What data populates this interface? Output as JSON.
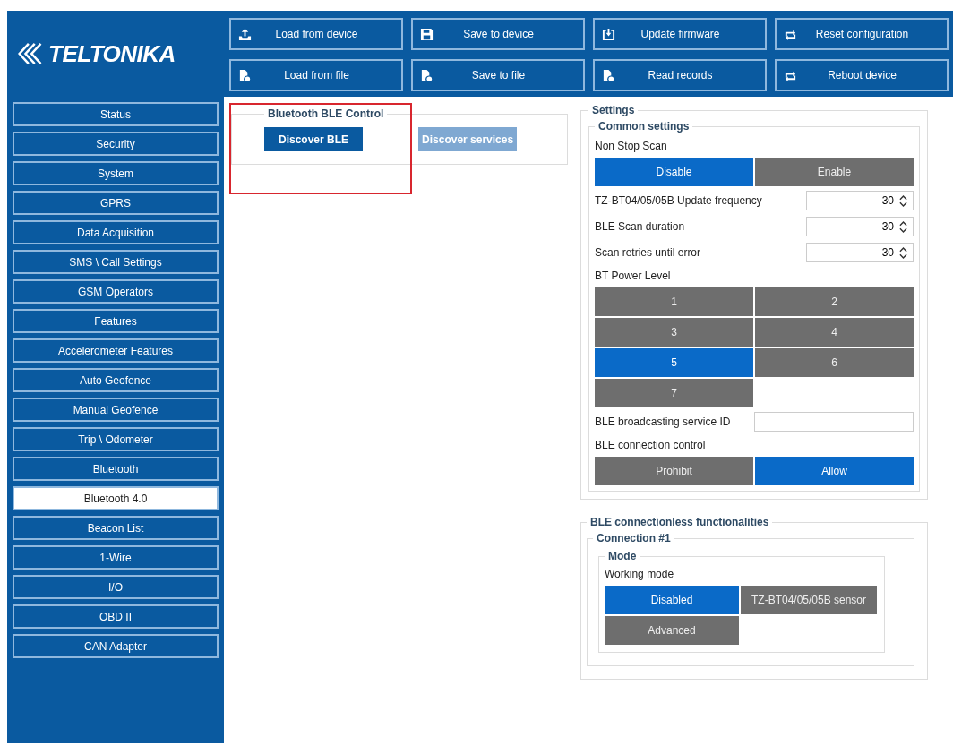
{
  "logo": {
    "text": "TELTONIKA"
  },
  "toolbar": [
    {
      "label": "Load from device",
      "kind": "upload"
    },
    {
      "label": "Save to device",
      "kind": "save"
    },
    {
      "label": "Update firmware",
      "kind": "update"
    },
    {
      "label": "Reset configuration",
      "kind": "reset"
    },
    {
      "label": "Load from file",
      "kind": "file"
    },
    {
      "label": "Save to file",
      "kind": "file"
    },
    {
      "label": "Read records",
      "kind": "file"
    },
    {
      "label": "Reboot device",
      "kind": "reset"
    }
  ],
  "sidebar": {
    "items": [
      {
        "label": "Status",
        "selected": false
      },
      {
        "label": "Security",
        "selected": false
      },
      {
        "label": "System",
        "selected": false
      },
      {
        "label": "GPRS",
        "selected": false
      },
      {
        "label": "Data Acquisition",
        "selected": false
      },
      {
        "label": "SMS \\ Call Settings",
        "selected": false
      },
      {
        "label": "GSM Operators",
        "selected": false
      },
      {
        "label": "Features",
        "selected": false
      },
      {
        "label": "Accelerometer Features",
        "selected": false
      },
      {
        "label": "Auto Geofence",
        "selected": false
      },
      {
        "label": "Manual Geofence",
        "selected": false
      },
      {
        "label": "Trip \\ Odometer",
        "selected": false
      },
      {
        "label": "Bluetooth",
        "selected": false
      },
      {
        "label": "Bluetooth 4.0",
        "selected": true
      },
      {
        "label": "Beacon List",
        "selected": false
      },
      {
        "label": "1-Wire",
        "selected": false
      },
      {
        "label": "I/O",
        "selected": false
      },
      {
        "label": "OBD II",
        "selected": false
      },
      {
        "label": "CAN Adapter",
        "selected": false
      }
    ]
  },
  "ble_control": {
    "title": "Bluetooth BLE Control",
    "buttons": [
      {
        "label": "Discover BLE",
        "disabled": false
      },
      {
        "label": "Discover services",
        "disabled": true
      }
    ]
  },
  "settings": {
    "title": "Settings",
    "common": {
      "title": "Common settings",
      "non_stop_scan": {
        "label": "Non Stop Scan",
        "options": [
          {
            "label": "Disable",
            "selected": true
          },
          {
            "label": "Enable",
            "selected": false
          }
        ]
      },
      "fields": [
        {
          "label": "TZ-BT04/05/05B Update frequency",
          "value": "30"
        },
        {
          "label": "BLE Scan duration",
          "value": "30"
        },
        {
          "label": "Scan retries until error",
          "value": "30"
        }
      ],
      "power_level": {
        "label": "BT Power Level",
        "options": [
          {
            "label": "1",
            "selected": false
          },
          {
            "label": "2",
            "selected": false
          },
          {
            "label": "3",
            "selected": false
          },
          {
            "label": "4",
            "selected": false
          },
          {
            "label": "5",
            "selected": true
          },
          {
            "label": "6",
            "selected": false
          },
          {
            "label": "7",
            "selected": false
          }
        ]
      },
      "service_id": {
        "label": "BLE broadcasting service ID"
      },
      "connection_control": {
        "label": "BLE connection control",
        "options": [
          {
            "label": "Prohibit",
            "selected": false
          },
          {
            "label": "Allow",
            "selected": true
          }
        ]
      }
    }
  },
  "connectionless": {
    "title": "BLE connectionless functionalities",
    "connection": {
      "title": "Connection #1",
      "mode": {
        "title": "Mode",
        "working_mode": {
          "label": "Working mode",
          "options": [
            {
              "label": "Disabled",
              "selected": true
            },
            {
              "label": "TZ-BT04/05/05B sensor",
              "selected": false
            },
            {
              "label": "Advanced",
              "selected": false
            }
          ]
        }
      }
    }
  }
}
